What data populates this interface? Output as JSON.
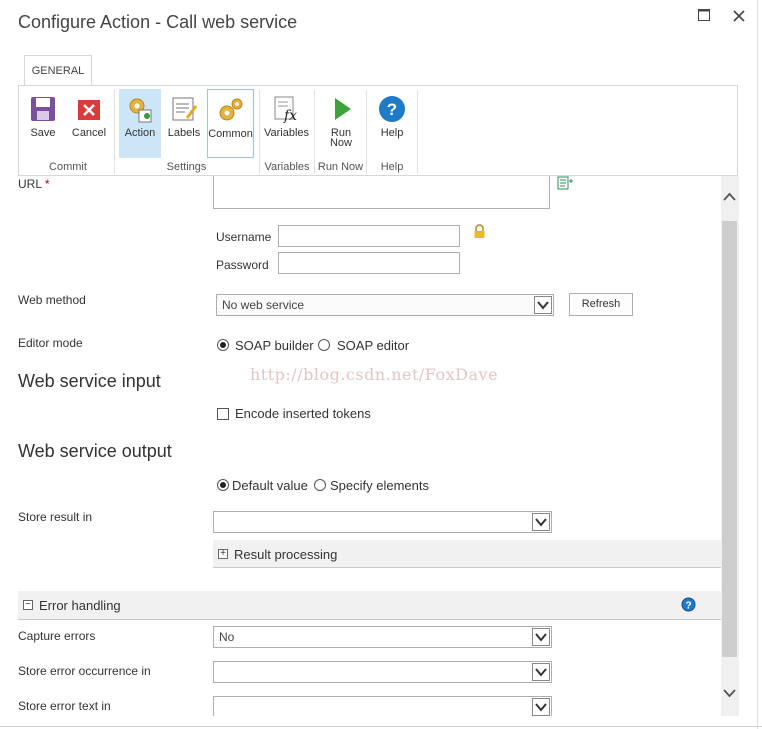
{
  "window": {
    "title": "Configure Action - Call web service",
    "maximize_icon": "maximize-icon",
    "close_icon": "close-icon"
  },
  "ribbon": {
    "tab": "GENERAL",
    "buttons": {
      "save": "Save",
      "cancel": "Cancel",
      "action": "Action",
      "labels": "Labels",
      "common": "Common",
      "variables": "Variables",
      "run_now_1": "Run",
      "run_now_2": "Now",
      "help": "Help"
    },
    "groups": {
      "commit": "Commit",
      "settings": "Settings",
      "variables": "Variables",
      "run_now": "Run Now",
      "help": "Help"
    }
  },
  "form": {
    "url_label": "URL",
    "url_required": "*",
    "username_label": "Username",
    "password_label": "Password",
    "web_method_label": "Web method",
    "web_method_value": "No web service",
    "refresh_label": "Refresh",
    "editor_mode_label": "Editor mode",
    "soap_builder": "SOAP builder",
    "soap_editor": "SOAP editor",
    "ws_input_heading": "Web service input",
    "encode_tokens": "Encode inserted tokens",
    "ws_output_heading": "Web service output",
    "default_value": "Default value",
    "specify_elements": "Specify elements",
    "store_result_label": "Store result in",
    "store_result_value": "",
    "result_processing": "Result processing",
    "error_handling": "Error handling",
    "capture_errors_label": "Capture errors",
    "capture_errors_value": "No",
    "store_error_occurrence_label": "Store error occurrence in",
    "store_error_text_label": "Store error text in"
  },
  "watermark": "http://blog.csdn.net/FoxDave",
  "colors": {
    "accent": "#0072c6",
    "selected": "#cde6f7",
    "required": "#c00000"
  }
}
